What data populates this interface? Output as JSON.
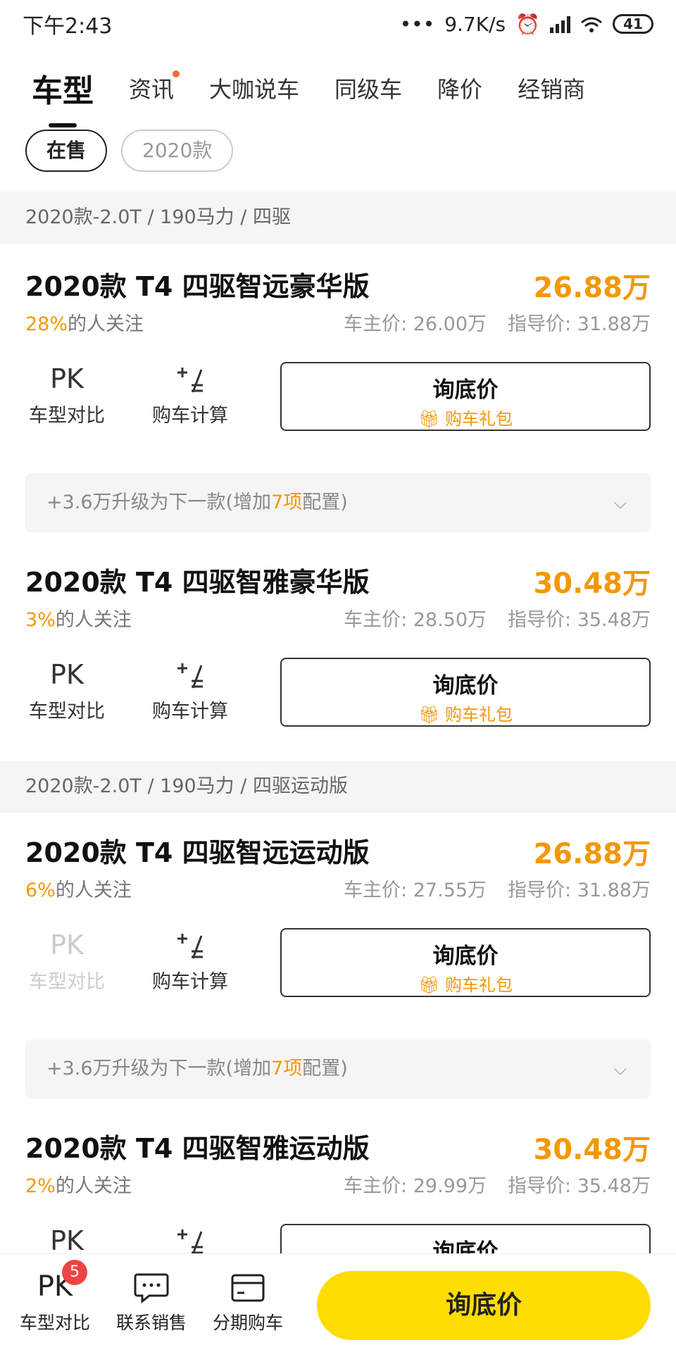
{
  "status": {
    "time": "下午2:43",
    "speed": "9.7K/s",
    "battery": "41"
  },
  "tabs": [
    {
      "label": "车型"
    },
    {
      "label": "资讯"
    },
    {
      "label": "大咖说车"
    },
    {
      "label": "同级车"
    },
    {
      "label": "降价"
    },
    {
      "label": "经销商"
    }
  ],
  "chips": [
    {
      "label": "在售"
    },
    {
      "label": "2020款"
    }
  ],
  "groups": [
    {
      "label": "2020款-2.0T / 190马力 / 四驱"
    },
    {
      "label": "2020款-2.0T / 190马力 / 四驱运动版"
    }
  ],
  "common": {
    "pk_icon": "PK",
    "pk_label": "车型对比",
    "calc_label": "购车计算",
    "ask_title": "询底价",
    "gift_label": "购车礼包",
    "attn_suffix": "的人关注"
  },
  "items": [
    {
      "name": "2020款 T4 四驱智远豪华版",
      "price": "26.88万",
      "pct": "28%",
      "owner_price": "车主价: 26.00万",
      "guide_price": "指导价: 31.88万"
    },
    {
      "name": "2020款 T4 四驱智雅豪华版",
      "price": "30.48万",
      "pct": "3%",
      "owner_price": "车主价: 28.50万",
      "guide_price": "指导价: 35.48万"
    },
    {
      "name": "2020款 T4 四驱智远运动版",
      "price": "26.88万",
      "pct": "6%",
      "owner_price": "车主价: 27.55万",
      "guide_price": "指导价: 31.88万"
    },
    {
      "name": "2020款 T4 四驱智雅运动版",
      "price": "30.48万",
      "pct": "2%",
      "owner_price": "车主价: 29.99万",
      "guide_price": "指导价: 35.48万"
    }
  ],
  "upgrades": [
    {
      "prefix": "+3.6万升级为下一款(增加",
      "count": "7项",
      "suffix": "配置)"
    },
    {
      "prefix": "+3.6万升级为下一款(增加",
      "count": "7项",
      "suffix": "配置)"
    }
  ],
  "bottom": {
    "compare": {
      "label": "车型对比",
      "icon": "PK",
      "badge": "5"
    },
    "contact": {
      "label": "联系销售"
    },
    "installment": {
      "label": "分期购车"
    },
    "cta": "询底价"
  },
  "colors": {
    "accent": "#f39800",
    "cta": "#ffdd00",
    "badge": "#ee4444"
  }
}
